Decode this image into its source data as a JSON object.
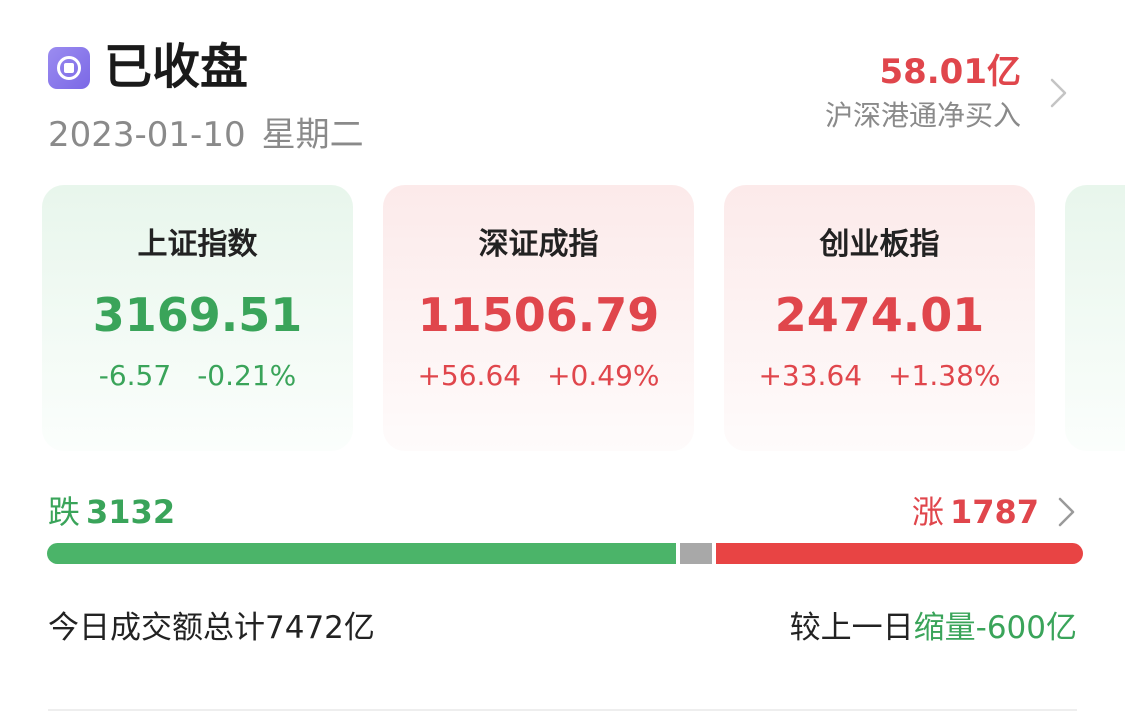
{
  "header": {
    "status_title": "已收盘",
    "date": "2023-01-10",
    "weekday": "星期二",
    "net_buy_value": "58.01亿",
    "net_buy_label": "沪深港通净买入"
  },
  "indices": [
    {
      "name": "上证指数",
      "value": "3169.51",
      "change": "-6.57",
      "change_pct": "-0.21%",
      "trend": "down"
    },
    {
      "name": "深证成指",
      "value": "11506.79",
      "change": "+56.64",
      "change_pct": "+0.49%",
      "trend": "up"
    },
    {
      "name": "创业板指",
      "value": "2474.01",
      "change": "+33.64",
      "change_pct": "+1.38%",
      "trend": "up"
    }
  ],
  "breadth": {
    "fall_label": "跌",
    "fall_count": 3132,
    "rise_label": "涨",
    "rise_count": 1787,
    "fall_fraction": 0.612,
    "flat_fraction": 0.031,
    "rise_fraction": 0.357
  },
  "turnover": {
    "text": "今日成交额总计7472亿",
    "compare_prefix": "较上一日",
    "compare_highlight": "缩量-600亿"
  },
  "colors": {
    "up": "#e0464c",
    "down": "#3aa45a",
    "flat": "#a8a8a8",
    "accent": "#7b68e6"
  },
  "icons": {
    "status": "stop-icon",
    "chevron": "chevron-right-icon"
  }
}
